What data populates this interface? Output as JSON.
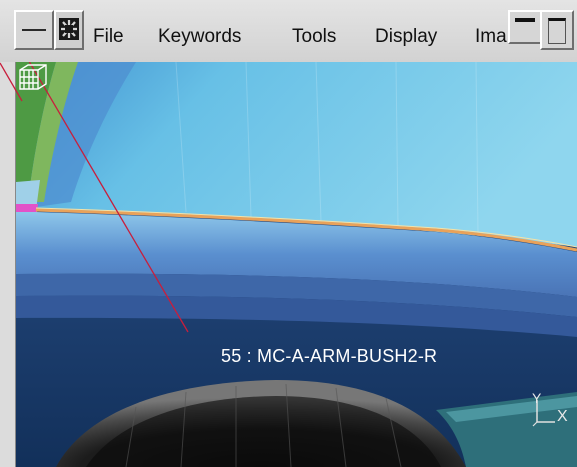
{
  "menu": {
    "items": [
      "File",
      "Keywords",
      "Tools",
      "Display",
      "Ima"
    ]
  },
  "viewport": {
    "part_label": "55 : MC-A-ARM-BUSH2-R",
    "axis_labels": {
      "y": "Y",
      "x": "X"
    }
  },
  "icons": {
    "app": "app-gear-icon",
    "part": "part-cube-icon",
    "axis": "axis-triad-icon"
  },
  "colors": {
    "menubar": "#d8d8d8",
    "sky": "#6bc3e6",
    "deep_blue": "#173a63",
    "pick_line": "#c81e3c",
    "orange_edge": "#e9a25a",
    "green_part": "#4e9a44",
    "magenta_part": "#e252c8"
  }
}
